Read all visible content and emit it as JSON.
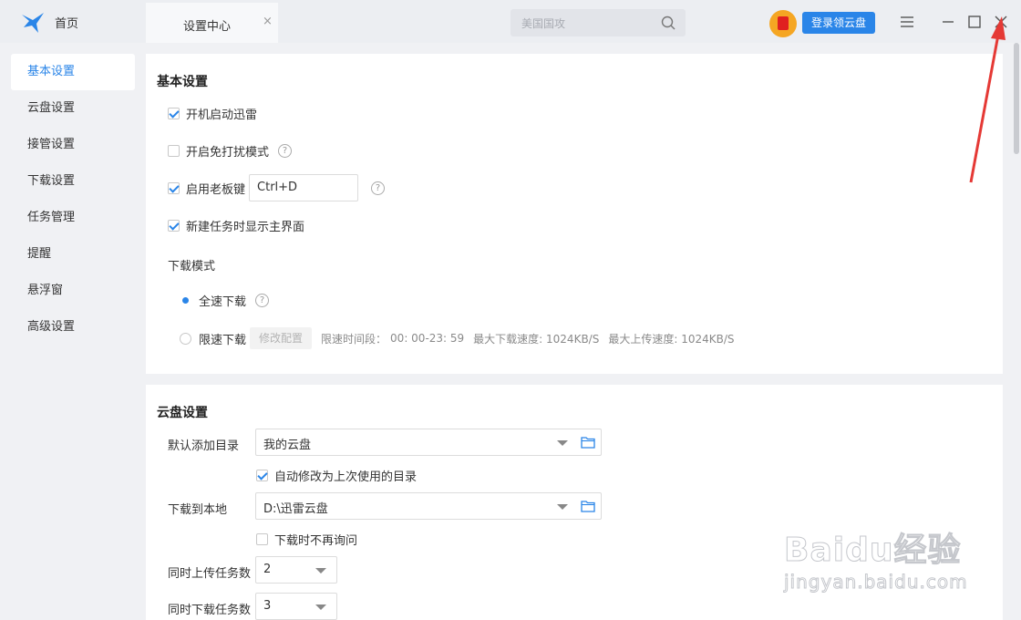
{
  "titlebar": {
    "home_label": "首页",
    "tab_label": "设置中心",
    "tab_close": "×",
    "search_placeholder": "美国国攻",
    "login_label": "登录领云盘"
  },
  "sidebar": {
    "items": [
      {
        "label": "基本设置",
        "active": true
      },
      {
        "label": "云盘设置"
      },
      {
        "label": "接管设置"
      },
      {
        "label": "下载设置"
      },
      {
        "label": "任务管理"
      },
      {
        "label": "提醒"
      },
      {
        "label": "悬浮窗"
      },
      {
        "label": "高级设置"
      }
    ]
  },
  "basic": {
    "title": "基本设置",
    "autostart": {
      "label": "开机启动迅雷",
      "checked": true
    },
    "dnd": {
      "label": "开启免打扰模式",
      "checked": false
    },
    "bosskey": {
      "label": "启用老板键",
      "checked": true,
      "value": "Ctrl+D"
    },
    "show_main": {
      "label": "新建任务时显示主界面",
      "checked": true
    },
    "mode_title": "下载模式",
    "full_speed": {
      "label": "全速下载",
      "selected": true
    },
    "limited": {
      "label": "限速下载",
      "selected": false,
      "config_btn": "修改配置",
      "time_label": "限速时间段：",
      "time_value": "00: 00-23: 59",
      "max_down": "最大下载速度: 1024KB/S",
      "max_up": "最大上传速度: 1024KB/S"
    },
    "help_glyph": "?"
  },
  "cloud": {
    "title": "云盘设置",
    "default_dir_label": "默认添加目录",
    "default_dir_value": "我的云盘",
    "auto_modify": {
      "label": "自动修改为上次使用的目录",
      "checked": true
    },
    "local_label": "下载到本地",
    "local_value": "D:\\迅雷云盘",
    "no_ask": {
      "label": "下载时不再询问",
      "checked": false
    },
    "upload_label": "同时上传任务数",
    "upload_value": "2",
    "download_label": "同时下载任务数",
    "download_value": "3"
  },
  "watermark": {
    "main": "Baidu经验",
    "sub": "jingyan.baidu.com"
  },
  "colors": {
    "accent": "#2a85e8",
    "annotation": "#e53935"
  }
}
